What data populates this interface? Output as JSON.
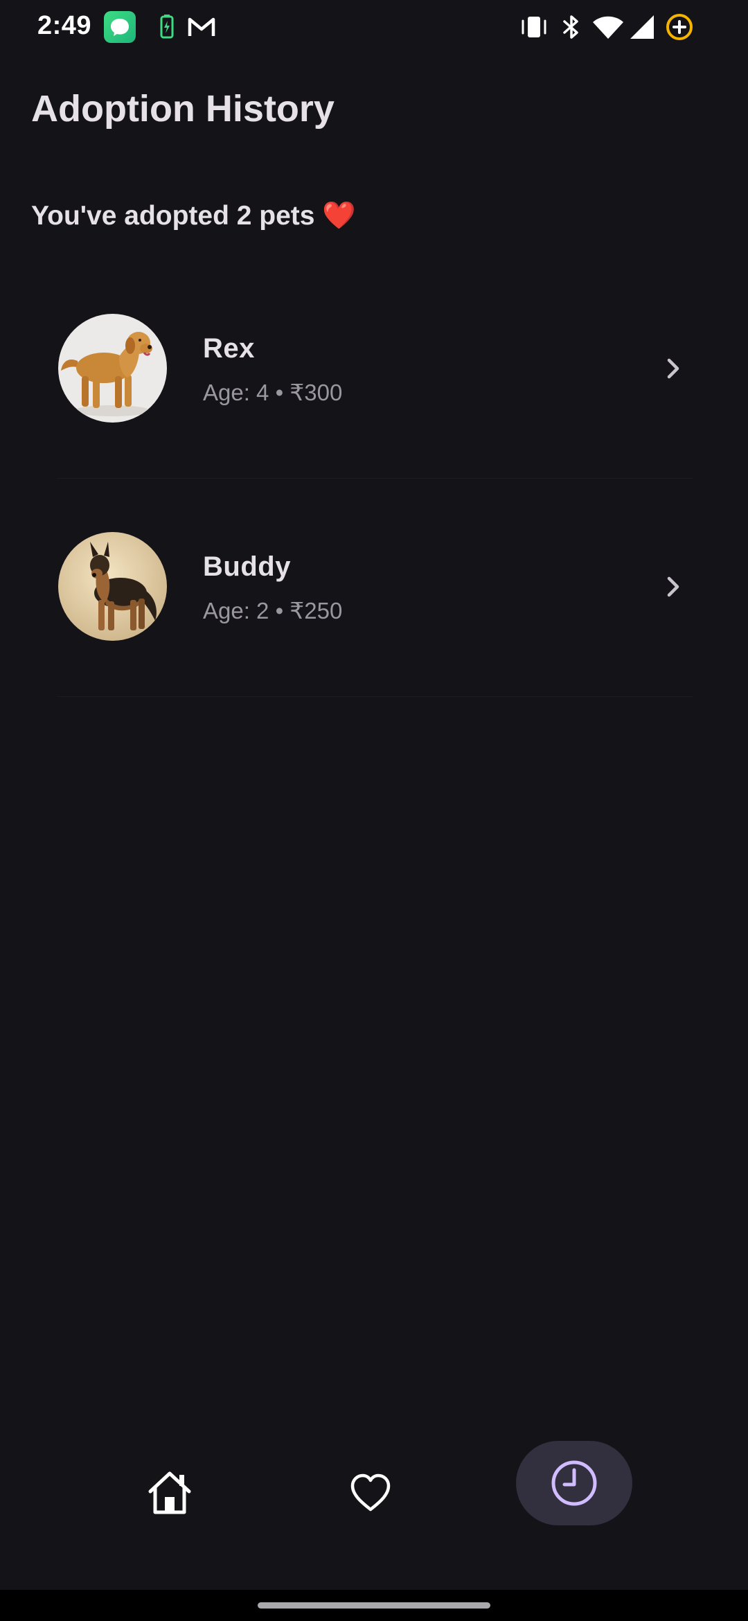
{
  "status_bar": {
    "time": "2:49",
    "notification_icons": [
      "messages-icon",
      "battery-charging-icon",
      "gmail-icon"
    ],
    "system_icons": [
      "vibrate-icon",
      "bluetooth-icon",
      "wifi-icon",
      "cellular-signal-icon",
      "data-saver-icon"
    ]
  },
  "header": {
    "title": "Adoption History"
  },
  "summary": {
    "text": "You've adopted 2 pets ❤️"
  },
  "pets": [
    {
      "name": "Rex",
      "meta": "Age: 4 • ₹300",
      "image": "golden-retriever"
    },
    {
      "name": "Buddy",
      "meta": "Age: 2 • ₹250",
      "image": "german-shepherd"
    }
  ],
  "bottom_nav": {
    "items": [
      {
        "name": "home",
        "icon": "home-icon",
        "selected": false
      },
      {
        "name": "favorites",
        "icon": "heart-icon",
        "selected": false
      },
      {
        "name": "history",
        "icon": "clock-icon",
        "selected": true
      }
    ],
    "selected_color": "#D0BCFF",
    "indicator_color": "#322F3E"
  },
  "colors": {
    "background": "#141318",
    "primary_text": "#E6E1E6",
    "secondary_text": "#9A979F"
  }
}
